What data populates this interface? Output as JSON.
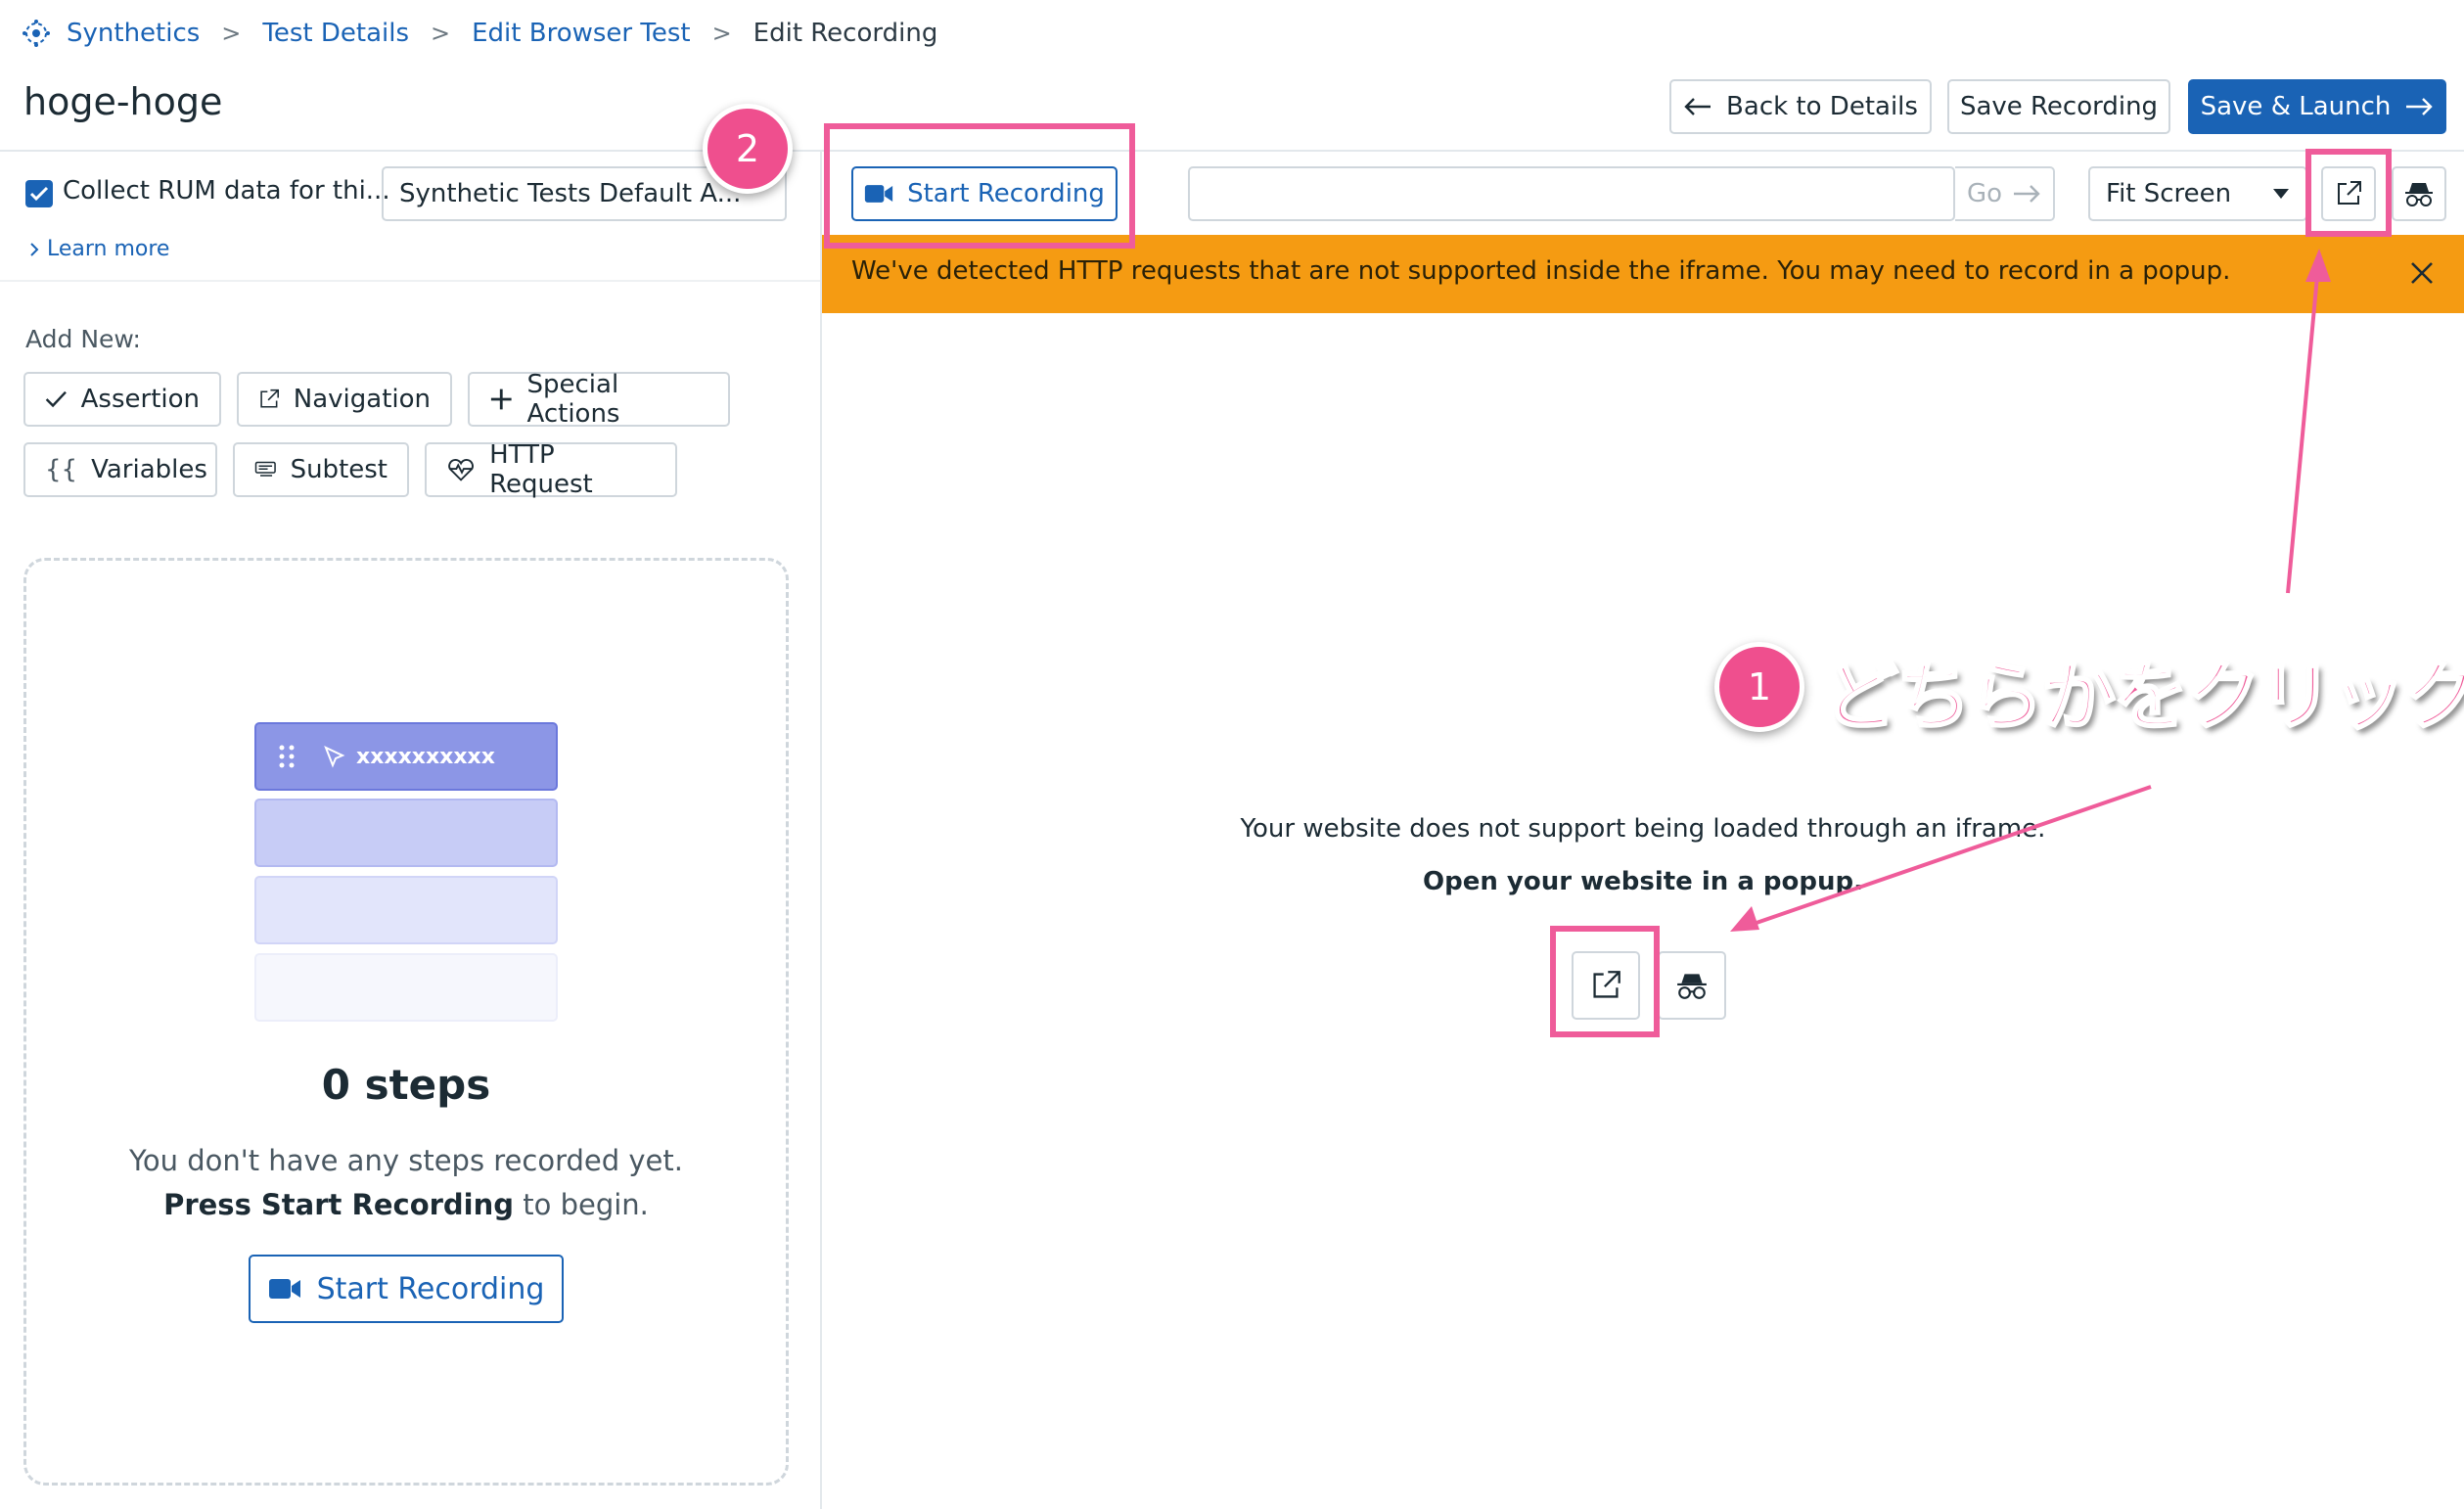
{
  "breadcrumb": {
    "items": [
      "Synthetics",
      "Test Details",
      "Edit Browser Test"
    ],
    "current": "Edit Recording"
  },
  "header": {
    "title": "hoge-hoge",
    "back_label": "Back to Details",
    "save_label": "Save Recording",
    "launch_label": "Save & Launch"
  },
  "sidebar": {
    "rum_label": "Collect RUM data for thi...",
    "rum_checked": true,
    "app_select_value": "Synthetic Tests Default A...",
    "learn_more": "Learn more",
    "add_new_label": "Add New:",
    "add_buttons": [
      "Assertion",
      "Navigation",
      "Special Actions",
      "Variables",
      "Subtest",
      "HTTP Request"
    ],
    "illustration_text": "xxxxxxxxxx",
    "steps_count": "0 steps",
    "steps_msg_line1": "You don't have any steps recorded yet.",
    "steps_msg_bold": "Press Start Recording",
    "steps_msg_tail": " to begin.",
    "start_recording": "Start Recording"
  },
  "toolbar": {
    "start_recording": "Start Recording",
    "url_value": "",
    "go_label": "Go",
    "fit_select": "Fit Screen"
  },
  "banner": {
    "text": "We've detected HTTP requests that are not supported inside the iframe. You may need to record in a popup."
  },
  "main": {
    "message": "Your website does not support being loaded through an iframe.",
    "message_bold": "Open your website in a popup."
  },
  "annotations": {
    "badge1": "1",
    "badge2": "2",
    "note": "どちらかをクリック",
    "color": "#ef5c9a"
  },
  "colors": {
    "primary": "#1a63b5",
    "warning": "#f59b12",
    "highlight": "#ef5c9a"
  }
}
